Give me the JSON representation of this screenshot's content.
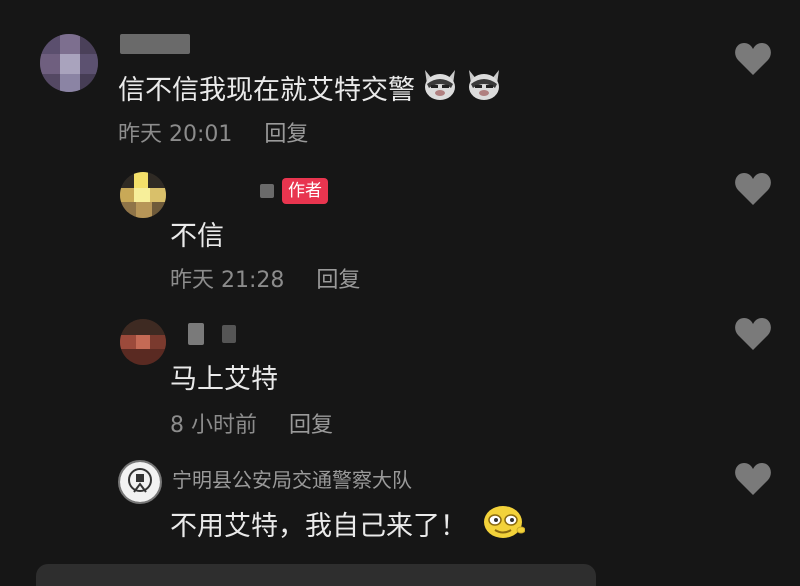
{
  "comments": [
    {
      "text": "信不信我现在就艾特交警",
      "time": "昨天 20:01",
      "reply_label": "回复",
      "emojis": [
        "cat-face-icon",
        "cat-face-icon"
      ]
    },
    {
      "badge": "作者",
      "text": "不信",
      "time": "昨天 21:28",
      "reply_label": "回复"
    },
    {
      "text": "马上艾特",
      "time": "8 小时前",
      "reply_label": "回复"
    },
    {
      "username": "宁明县公安局交通警察大队",
      "text": "不用艾特，我自己来了！",
      "emoji": "smiling-face-icon"
    }
  ],
  "colors": {
    "background": "#161616",
    "author_badge": "#e8354f",
    "meta_text": "#8c8c8c"
  }
}
